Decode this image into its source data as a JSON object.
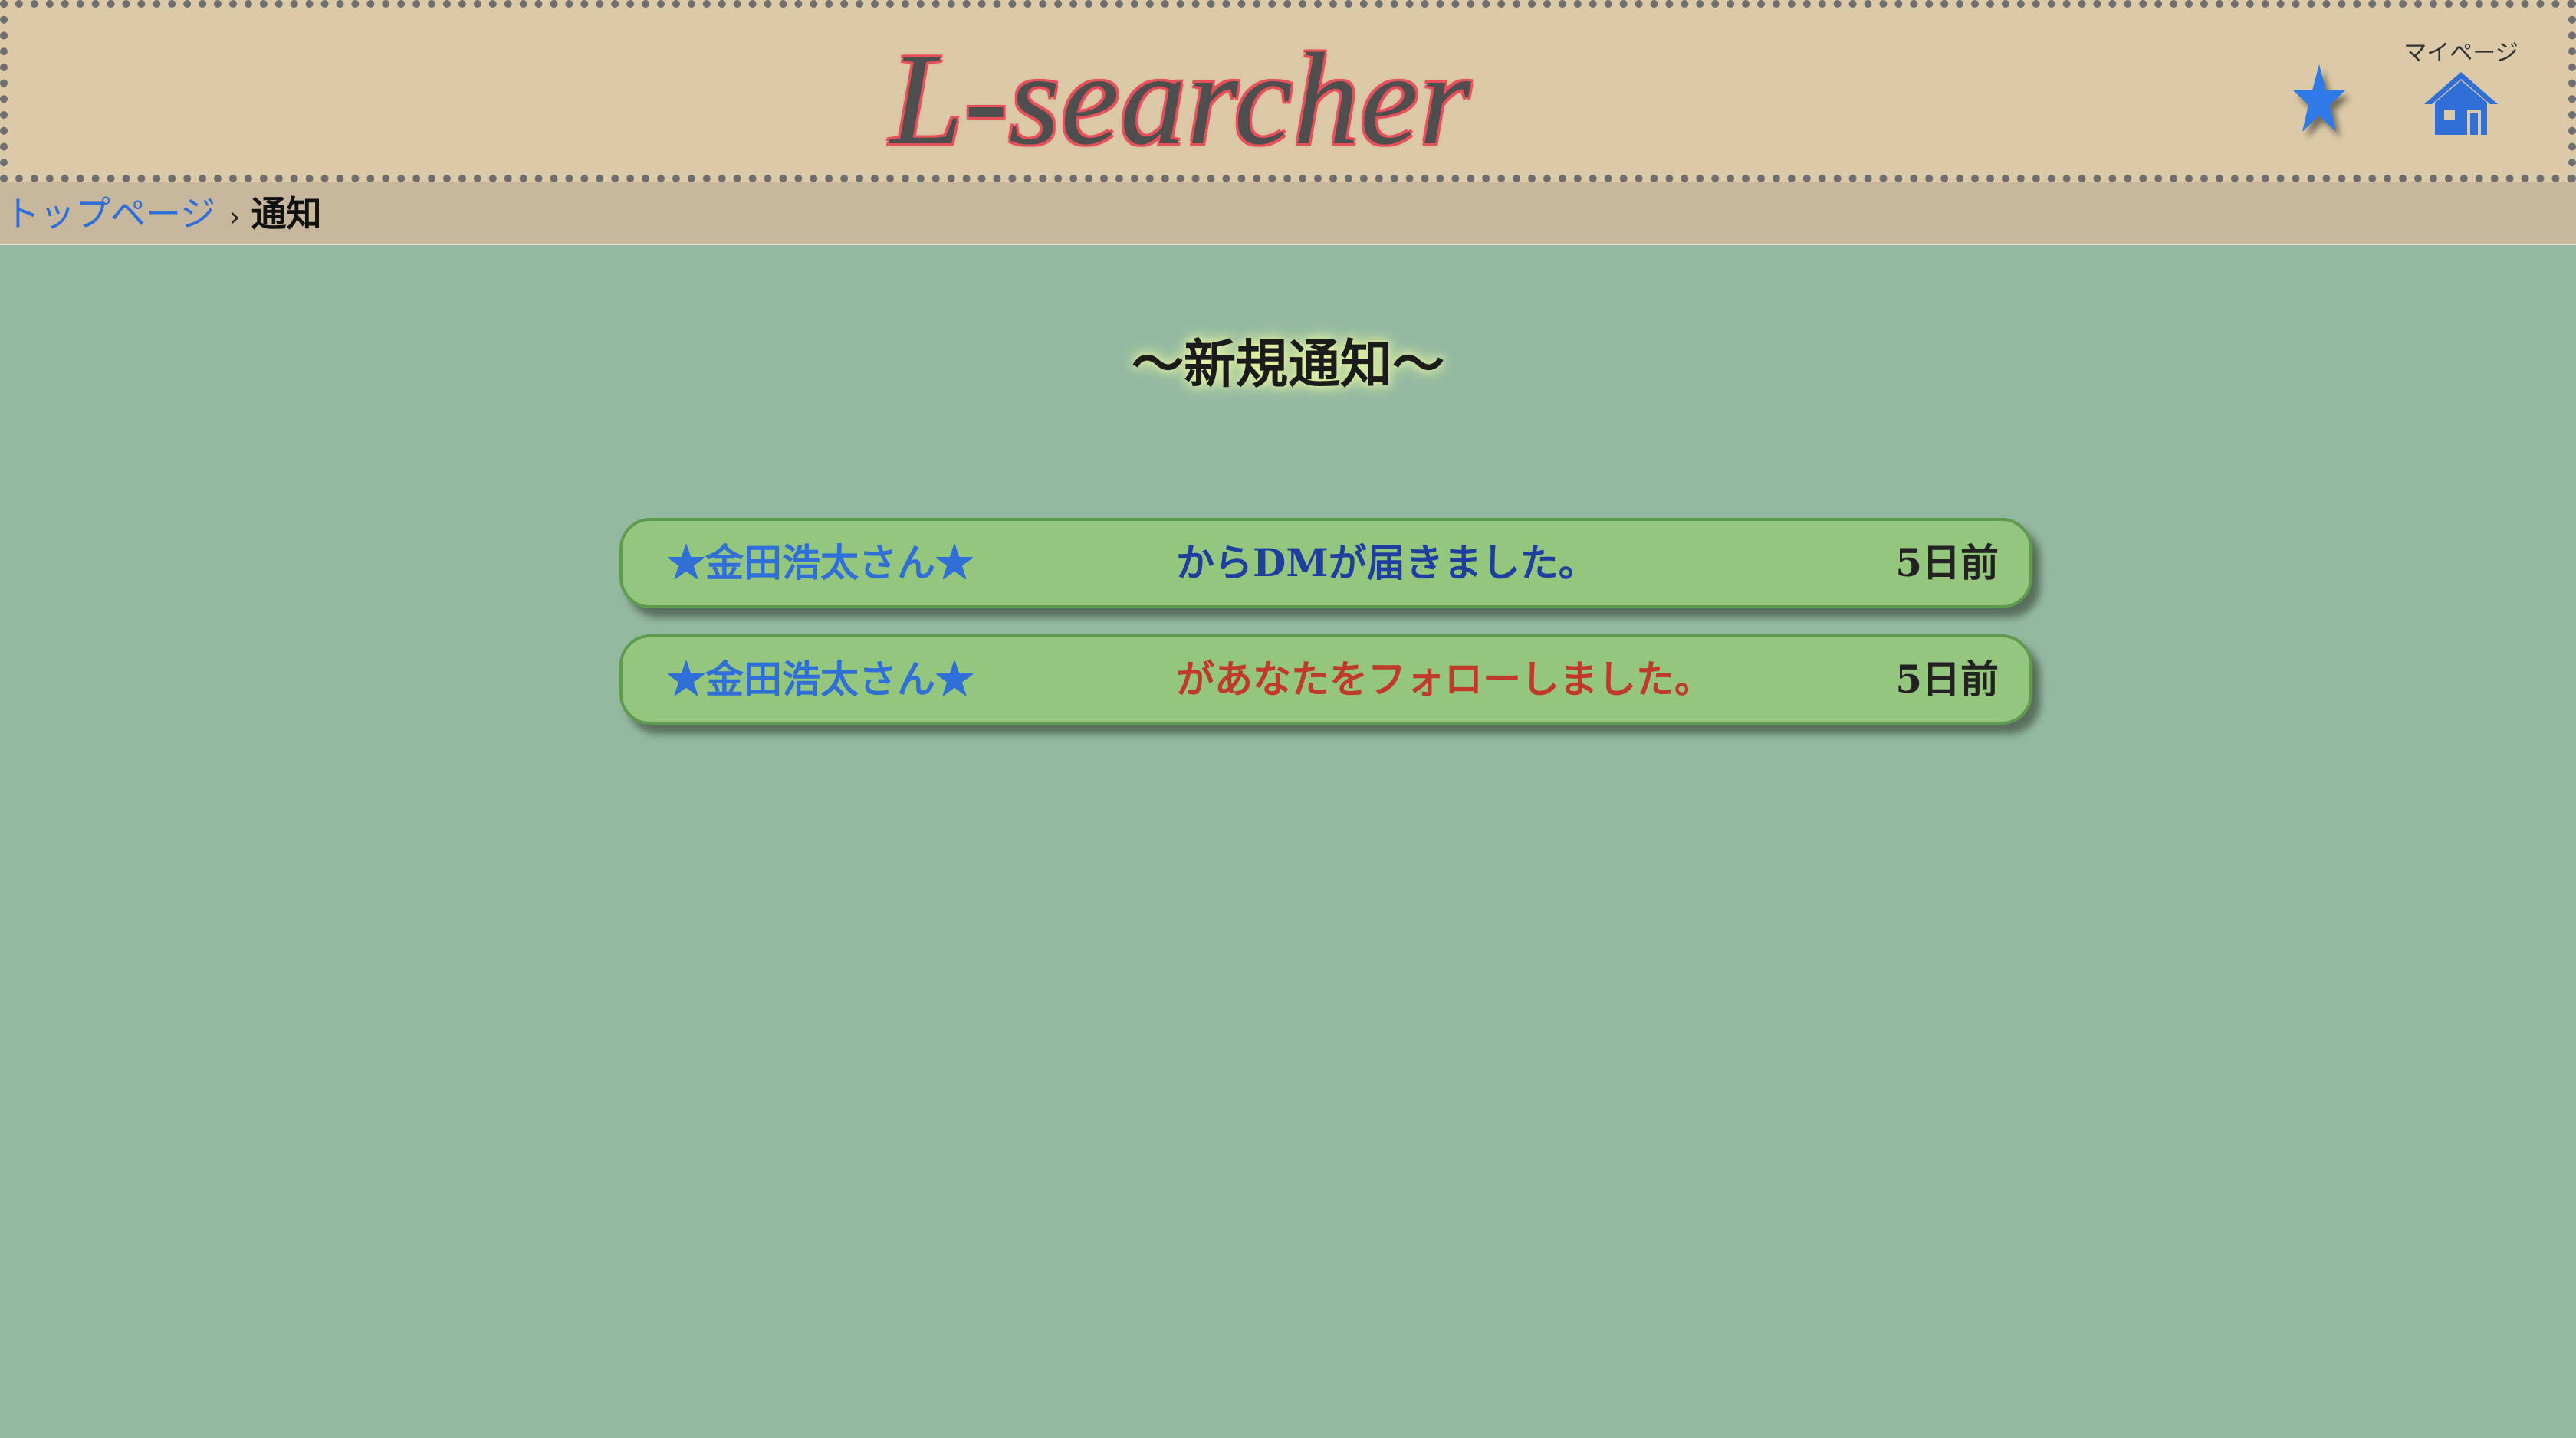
{
  "header": {
    "logo": "L-searcher",
    "mypage_label": "マイページ"
  },
  "breadcrumb": {
    "home": "トップページ",
    "separator": "›",
    "current": "通知"
  },
  "page_title": "〜新規通知〜",
  "notifications": [
    {
      "sender": "★金田浩太さん★",
      "message": "からDMが届きました。",
      "time": "5日前",
      "type": "dm"
    },
    {
      "sender": "★金田浩太さん★",
      "message": "があなたをフォローしました。",
      "time": "5日前",
      "type": "follow"
    }
  ],
  "colors": {
    "background": "#94b9a1",
    "header_bg": "#dbc9a7",
    "breadcrumb_bg": "#c7b79c",
    "card_bg": "#94c77d",
    "link_blue": "#2f6fd6",
    "dm_text": "#1f3fa0",
    "follow_text": "#c0392b",
    "logo_outline": "#e6505a"
  },
  "icons": {
    "favorites": "star-icon",
    "mypage": "house-icon"
  }
}
